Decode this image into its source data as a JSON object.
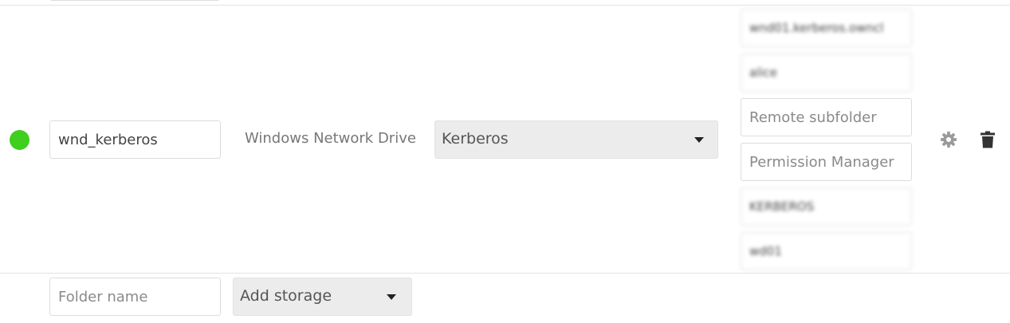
{
  "storage_row": {
    "status_color": "#3fcf1e",
    "folder_name_value": "wnd_kerberos",
    "backend_label": "Windows Network Drive",
    "auth_selected": "Kerberos",
    "config": {
      "host_value": "wnd01.kerberos.owncl",
      "username_value": "alice",
      "remote_subfolder_placeholder": "Remote subfolder",
      "permission_manager_placeholder": "Permission Manager",
      "domain_value": "KERBEROS",
      "service_account_value": "wd01"
    },
    "actions": {
      "settings_icon": "gear-icon",
      "delete_icon": "trash-icon"
    }
  },
  "new_storage_row": {
    "folder_name_placeholder": "Folder name",
    "add_storage_label": "Add storage"
  }
}
